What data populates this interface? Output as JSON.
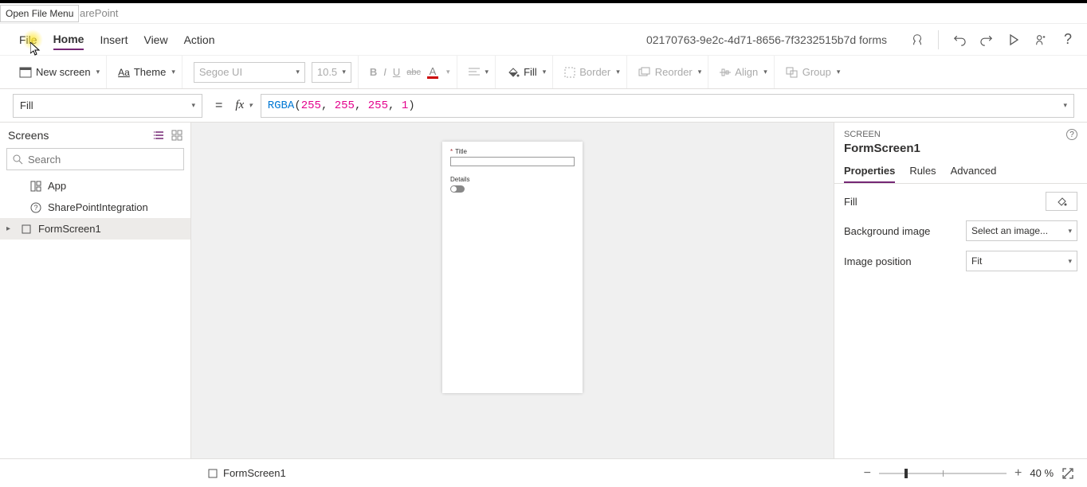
{
  "tooltip": "Open File Menu",
  "breadcrumb_suffix": "arePoint",
  "menu": {
    "file": "File",
    "home": "Home",
    "insert": "Insert",
    "view": "View",
    "action": "Action"
  },
  "doc_title": "02170763-9e2c-4d71-8656-7f3232515b7d forms",
  "toolbar": {
    "new_screen": "New screen",
    "theme": "Theme",
    "font": "Segoe UI",
    "font_size": "10.5",
    "fill": "Fill",
    "border": "Border",
    "reorder": "Reorder",
    "align": "Align",
    "group": "Group"
  },
  "formula": {
    "property": "Fill",
    "fn_name": "RGBA",
    "arg1": "255",
    "arg2": "255",
    "arg3": "255",
    "arg4": "1"
  },
  "sidebar": {
    "title": "Screens",
    "search_placeholder": "Search",
    "items": [
      {
        "label": "App"
      },
      {
        "label": "SharePointIntegration"
      },
      {
        "label": "FormScreen1"
      }
    ]
  },
  "canvas": {
    "title_label": "Title",
    "details_label": "Details"
  },
  "props": {
    "section": "Screen",
    "name": "FormScreen1",
    "tabs": {
      "properties": "Properties",
      "rules": "Rules",
      "advanced": "Advanced"
    },
    "fill_label": "Fill",
    "bg_label": "Background image",
    "bg_value": "Select an image...",
    "pos_label": "Image position",
    "pos_value": "Fit"
  },
  "status": {
    "screen": "FormScreen1",
    "zoom": "40",
    "zoom_unit": "%"
  }
}
